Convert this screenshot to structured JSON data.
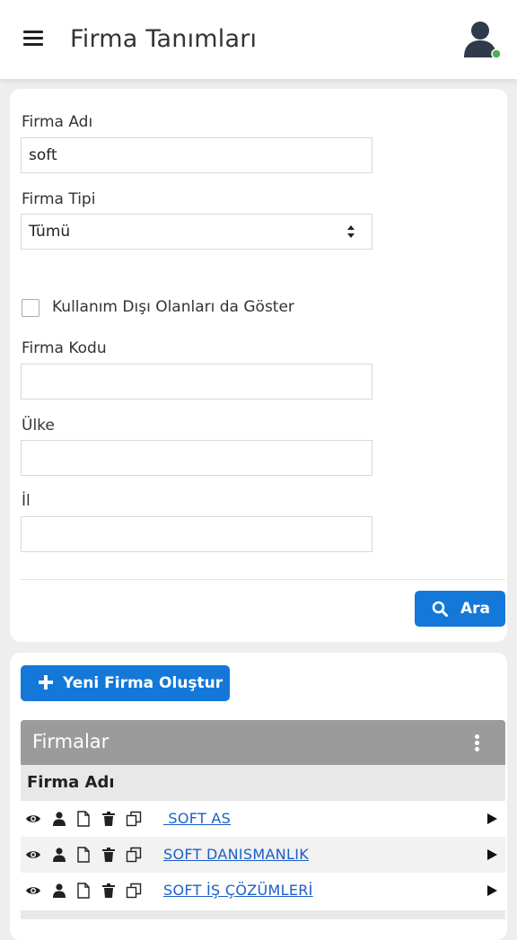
{
  "header": {
    "title": "Firma Tanımları",
    "menu_icon": "hamburger-menu-icon",
    "avatar_icon": "user-avatar-icon",
    "online_status_color": "#4caf50"
  },
  "filters": {
    "firma_adi": {
      "label": "Firma Adı",
      "value": "soft"
    },
    "firma_tipi": {
      "label": "Firma Tipi",
      "selected": "Tümü"
    },
    "show_inactive": {
      "label": "Kullanım Dışı Olanları da Göster",
      "checked": false
    },
    "firma_kodu": {
      "label": "Firma Kodu",
      "value": ""
    },
    "ulke": {
      "label": "Ülke",
      "value": ""
    },
    "il": {
      "label": "İl",
      "value": ""
    },
    "search_button": "Ara"
  },
  "new_button": "Yeni Firma Oluştur",
  "grid": {
    "title": "Firmalar",
    "column": "Firma Adı",
    "rows": [
      {
        "name": " SOFT AS"
      },
      {
        "name": "SOFT DANISMANLIK"
      },
      {
        "name": "SOFT İŞ ÇÖZÜMLERİ"
      }
    ],
    "row_actions": [
      "view-eye-icon",
      "user-icon",
      "document-icon",
      "trash-icon",
      "copy-icon"
    ]
  },
  "colors": {
    "accent": "#1478d8",
    "link": "#1a5fc8",
    "grid_header": "#9b9b9b"
  }
}
